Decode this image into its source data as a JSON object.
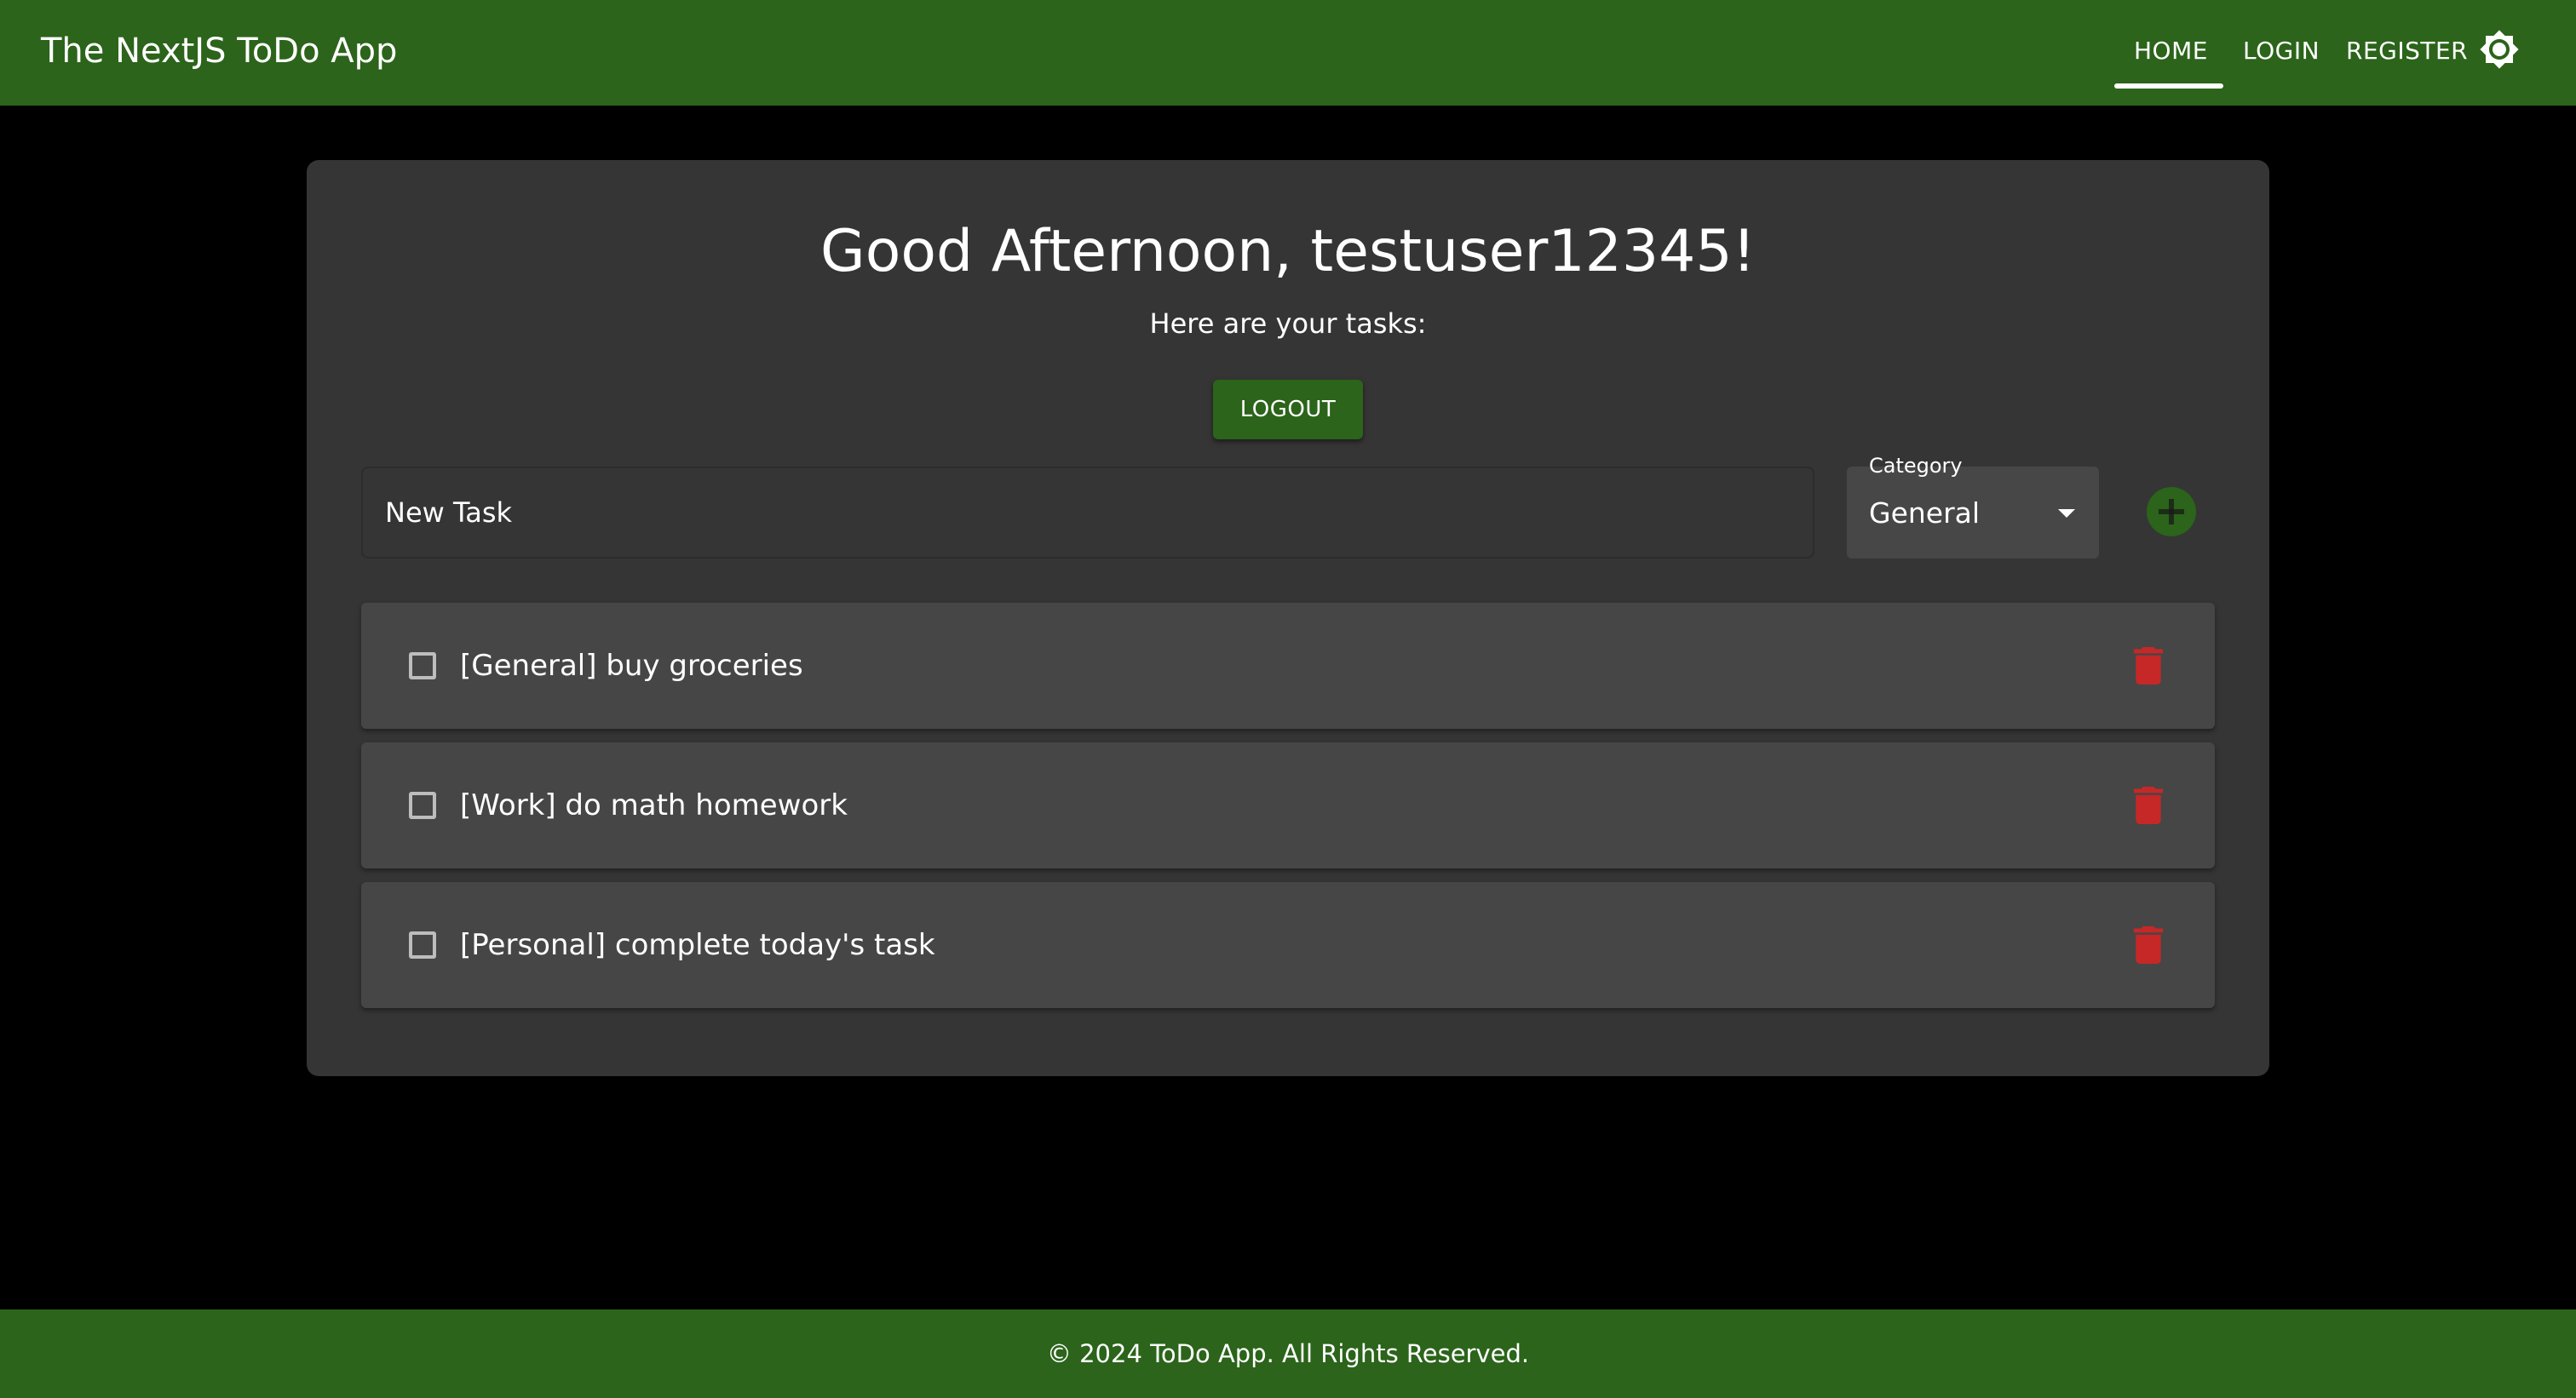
{
  "header": {
    "app_title": "The NextJS ToDo App",
    "nav": {
      "home": "HOME",
      "login": "LOGIN",
      "register": "REGISTER",
      "active": "HOME"
    },
    "theme_icon": "brightness-icon"
  },
  "main": {
    "greeting": "Good Afternoon, testuser12345!",
    "subtitle": "Here are your tasks:",
    "logout_label": "LOGOUT",
    "new_task": {
      "placeholder": "New Task",
      "value": ""
    },
    "category": {
      "label": "Category",
      "selected": "General"
    },
    "add_icon": "add-circle-icon",
    "tasks": [
      {
        "text": "[General] buy groceries",
        "completed": false
      },
      {
        "text": "[Work] do math homework",
        "completed": false
      },
      {
        "text": "[Personal] complete today's task",
        "completed": false
      }
    ],
    "delete_icon": "trash-icon"
  },
  "footer": {
    "text": "© 2024 ToDo App. All Rights Reserved."
  },
  "colors": {
    "primary": "#2b641a",
    "background": "#000000",
    "card": "#353535",
    "task_row": "#464646",
    "delete": "#c62828",
    "add": "#2b641a"
  }
}
